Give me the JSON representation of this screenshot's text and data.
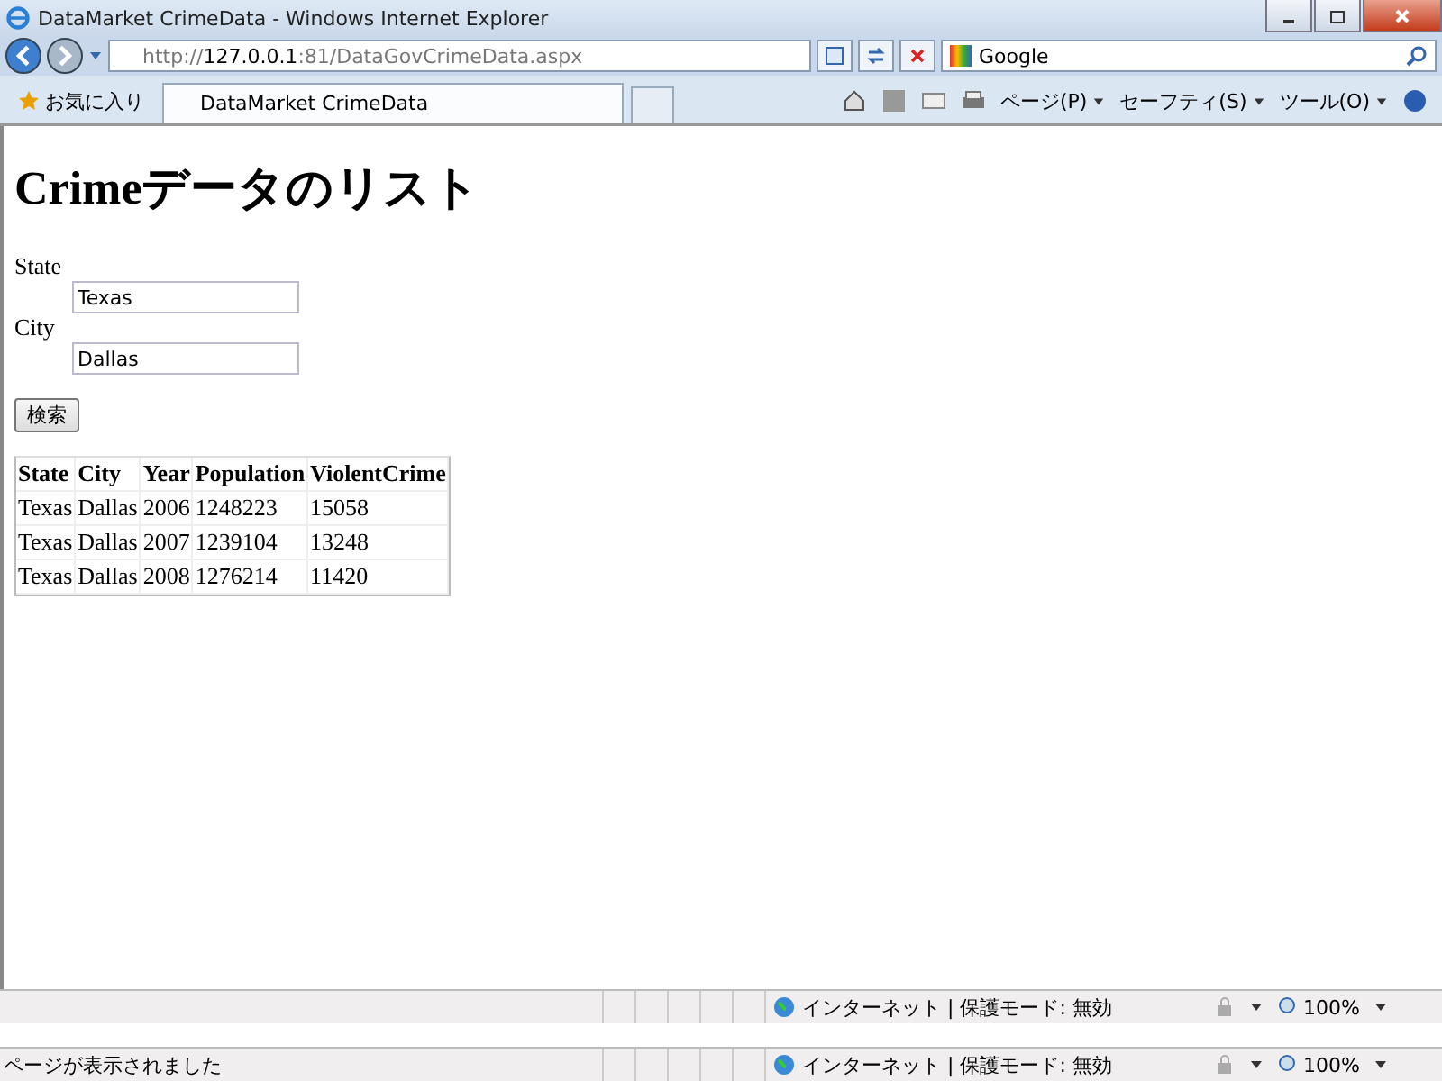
{
  "window": {
    "title": "DataMarket CrimeData - Windows Internet Explorer"
  },
  "address_bar": {
    "url_prefix": "http://",
    "url_host": "127.0.0.1",
    "url_rest": ":81/DataGovCrimeData.aspx"
  },
  "search_box": {
    "value": "Google"
  },
  "favorites": {
    "label": "お気に入り"
  },
  "tabs": [
    {
      "label": "DataMarket CrimeData",
      "selected": true
    }
  ],
  "command_bar": [
    "ページ(P)",
    "セーフティ(S)",
    "ツール(O)"
  ],
  "page": {
    "heading": "Crimeデータのリスト",
    "fields": [
      {
        "label": "State",
        "value": "Texas"
      },
      {
        "label": "City",
        "value": "Dallas"
      }
    ],
    "search_button": "検索",
    "table": {
      "columns": [
        "State",
        "City",
        "Year",
        "Population",
        "ViolentCrime"
      ],
      "rows": [
        [
          "Texas",
          "Dallas",
          "2006",
          "1248223",
          "15058"
        ],
        [
          "Texas",
          "Dallas",
          "2007",
          "1239104",
          "13248"
        ],
        [
          "Texas",
          "Dallas",
          "2008",
          "1276214",
          "11420"
        ]
      ]
    }
  },
  "status_bars": [
    {
      "zone": "インターネット | 保護モード: 無効",
      "zoom": "100%"
    },
    {
      "message": "ページが表示されました",
      "zone": "インターネット | 保護モード: 無効",
      "zoom": "100%"
    }
  ]
}
